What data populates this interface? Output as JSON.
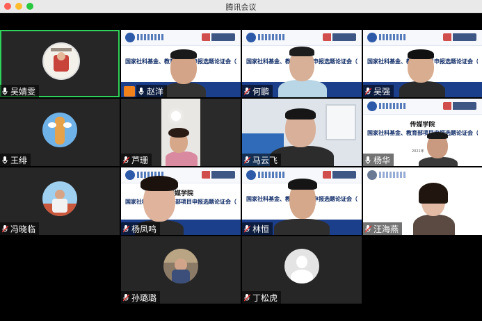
{
  "window": {
    "title": "腾讯会议"
  },
  "slide": {
    "school": "传媒学院",
    "title": "国家社科基金、教育部项目申报选题论证会（一）",
    "date": "2021年"
  },
  "participants": [
    {
      "name": "吴婧雯",
      "mic": "on"
    },
    {
      "name": "赵洋",
      "mic": "on"
    },
    {
      "name": "何鹏",
      "mic": "off"
    },
    {
      "name": "吴强",
      "mic": "off"
    },
    {
      "name": "王绯",
      "mic": "on"
    },
    {
      "name": "芦珊",
      "mic": "off"
    },
    {
      "name": "马云飞",
      "mic": "off"
    },
    {
      "name": "杨华",
      "mic": "on"
    },
    {
      "name": "冯晓临",
      "mic": "off"
    },
    {
      "name": "杨凤鸣",
      "mic": "off"
    },
    {
      "name": "林恒",
      "mic": "off"
    },
    {
      "name": "汪海燕",
      "mic": "off"
    },
    {
      "name": "孙璐璐",
      "mic": "off"
    },
    {
      "name": "丁松虎",
      "mic": "off"
    }
  ],
  "colors": {
    "active_speaker_border": "#2fd25a",
    "host_badge": "#f0811b",
    "slide_blue": "#1c3f8c"
  }
}
